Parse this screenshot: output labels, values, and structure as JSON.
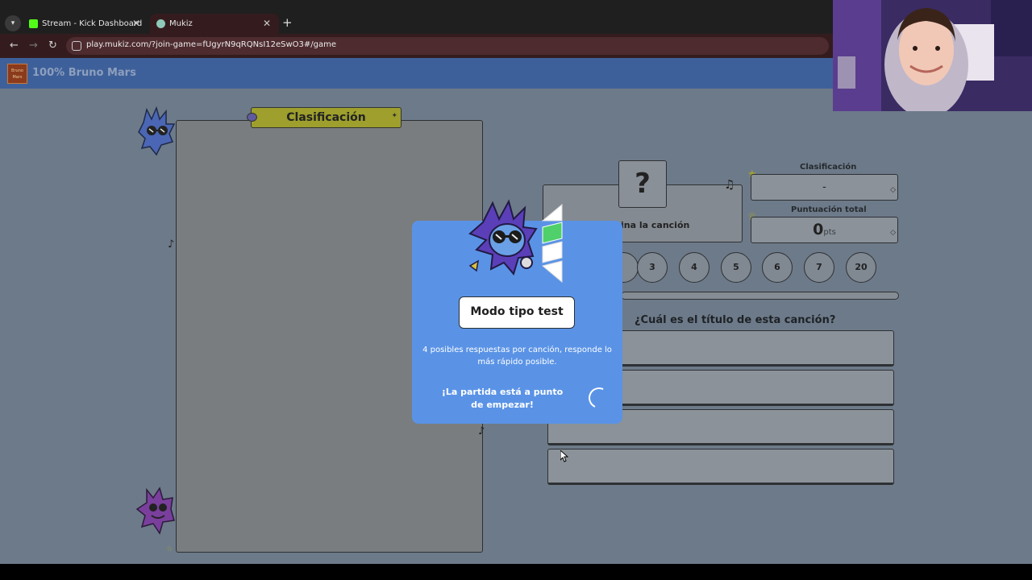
{
  "browser": {
    "tab_menu_icon": "chevron-down-icon",
    "tabs": [
      {
        "title": "Stream - Kick Dashboard"
      },
      {
        "title": "Mukiz"
      }
    ],
    "tab_close": "✕",
    "new_tab": "+",
    "back": "←",
    "forward": "→",
    "reload": "↻",
    "url": "play.mukiz.com/?join-game=fUgyrN9qRQNsI12eSwO3#/game"
  },
  "app": {
    "logo_text": "Bruno Mars",
    "title": "100% Bruno Mars"
  },
  "leaderboard": {
    "title": "Clasificación",
    "star": "✦"
  },
  "game": {
    "question_mark": "?",
    "hint_partial": "ina la canción",
    "stats": {
      "rank_label": "Clasificación",
      "rank_value": "-",
      "score_label": "Puntuación total",
      "score_value": "0",
      "score_unit": "pts"
    },
    "rounds": [
      "3",
      "4",
      "5",
      "6",
      "7",
      "20"
    ],
    "question": "¿Cuál es el título de esta canción?",
    "answers": [
      "",
      "",
      "",
      ""
    ]
  },
  "modal": {
    "mode_label": "Modo tipo test",
    "description": "4 posibles respuestas por canción, responde lo más rápido posible.",
    "start_message": "¡La partida está a punto de empezar!"
  },
  "colors": {
    "modal_bg": "#5a93e6",
    "header_bg": "#3e609a",
    "leader_title_bg": "#9e9f2c",
    "page_overlay": "#6d7a89"
  }
}
